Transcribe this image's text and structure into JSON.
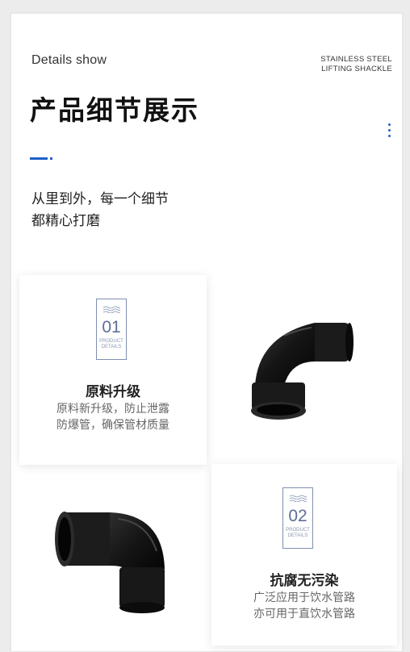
{
  "header": {
    "details_show": "Details show",
    "brand_line1": "STAINLESS STEEL",
    "brand_line2": "LIFTING SHACKLE",
    "title": "产品细节展示"
  },
  "intro": {
    "line1": "从里到外，每一个细节",
    "line2": "都精心打磨"
  },
  "features": [
    {
      "number": "01",
      "badge_line1": "PRODUCT",
      "badge_line2": "DETAILS",
      "title": "原料升级",
      "desc_line1": "原料新升级，防止泄露",
      "desc_line2": "防爆管，确保管材质量"
    },
    {
      "number": "02",
      "badge_line1": "PRODUCT",
      "badge_line2": "DETAILS",
      "title": "抗腐无污染",
      "desc_line1": "广泛应用于饮水管路",
      "desc_line2": "亦可用于直饮水管路"
    }
  ],
  "colors": {
    "accent": "#1f5fc7",
    "badge": "#5c6f9a",
    "product": "#161616"
  },
  "icons": [
    "wave-icon",
    "vertical-dots-icon",
    "pipe-elbow-image"
  ]
}
